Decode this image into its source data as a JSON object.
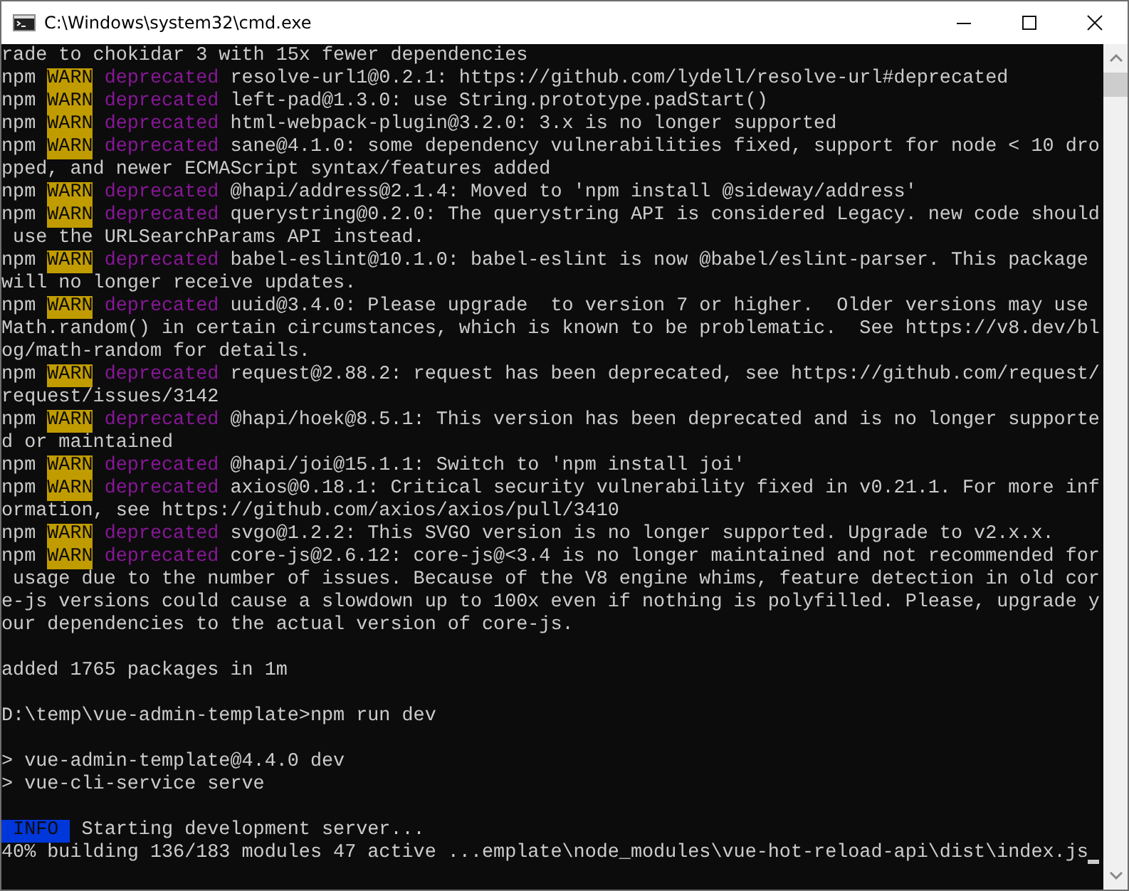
{
  "window": {
    "title": "C:\\Windows\\system32\\cmd.exe"
  },
  "console": {
    "cursor": true,
    "lines": [
      {
        "kind": "plain",
        "text": "rade to chokidar 3 with 15x fewer dependencies"
      },
      {
        "kind": "warn",
        "prefix": "npm",
        "level": "WARN",
        "tag": "deprecated",
        "text": "resolve-url1@0.2.1: https://github.com/lydell/resolve-url#deprecated"
      },
      {
        "kind": "warn",
        "prefix": "npm",
        "level": "WARN",
        "tag": "deprecated",
        "text": "left-pad@1.3.0: use String.prototype.padStart()"
      },
      {
        "kind": "warn",
        "prefix": "npm",
        "level": "WARN",
        "tag": "deprecated",
        "text": "html-webpack-plugin@3.2.0: 3.x is no longer supported"
      },
      {
        "kind": "warn",
        "prefix": "npm",
        "level": "WARN",
        "tag": "deprecated",
        "text": "sane@4.1.0: some dependency vulnerabilities fixed, support for node < 10 dro"
      },
      {
        "kind": "plain",
        "text": "pped, and newer ECMAScript syntax/features added"
      },
      {
        "kind": "warn",
        "prefix": "npm",
        "level": "WARN",
        "tag": "deprecated",
        "text": "@hapi/address@2.1.4: Moved to 'npm install @sideway/address'"
      },
      {
        "kind": "warn",
        "prefix": "npm",
        "level": "WARN",
        "tag": "deprecated",
        "text": "querystring@0.2.0: The querystring API is considered Legacy. new code should"
      },
      {
        "kind": "plain",
        "text": " use the URLSearchParams API instead."
      },
      {
        "kind": "warn",
        "prefix": "npm",
        "level": "WARN",
        "tag": "deprecated",
        "text": "babel-eslint@10.1.0: babel-eslint is now @babel/eslint-parser. This package"
      },
      {
        "kind": "plain",
        "text": "will no longer receive updates."
      },
      {
        "kind": "warn",
        "prefix": "npm",
        "level": "WARN",
        "tag": "deprecated",
        "text": "uuid@3.4.0: Please upgrade  to version 7 or higher.  Older versions may use"
      },
      {
        "kind": "plain",
        "text": "Math.random() in certain circumstances, which is known to be problematic.  See https://v8.dev/bl"
      },
      {
        "kind": "plain",
        "text": "og/math-random for details."
      },
      {
        "kind": "warn",
        "prefix": "npm",
        "level": "WARN",
        "tag": "deprecated",
        "text": "request@2.88.2: request has been deprecated, see https://github.com/request/"
      },
      {
        "kind": "plain",
        "text": "request/issues/3142"
      },
      {
        "kind": "warn",
        "prefix": "npm",
        "level": "WARN",
        "tag": "deprecated",
        "text": "@hapi/hoek@8.5.1: This version has been deprecated and is no longer supporte"
      },
      {
        "kind": "plain",
        "text": "d or maintained"
      },
      {
        "kind": "warn",
        "prefix": "npm",
        "level": "WARN",
        "tag": "deprecated",
        "text": "@hapi/joi@15.1.1: Switch to 'npm install joi'"
      },
      {
        "kind": "warn",
        "prefix": "npm",
        "level": "WARN",
        "tag": "deprecated",
        "text": "axios@0.18.1: Critical security vulnerability fixed in v0.21.1. For more inf"
      },
      {
        "kind": "plain",
        "text": "ormation, see https://github.com/axios/axios/pull/3410"
      },
      {
        "kind": "warn",
        "prefix": "npm",
        "level": "WARN",
        "tag": "deprecated",
        "text": "svgo@1.2.2: This SVGO version is no longer supported. Upgrade to v2.x.x."
      },
      {
        "kind": "warn",
        "prefix": "npm",
        "level": "WARN",
        "tag": "deprecated",
        "text": "core-js@2.6.12: core-js@<3.4 is no longer maintained and not recommended for"
      },
      {
        "kind": "plain",
        "text": " usage due to the number of issues. Because of the V8 engine whims, feature detection in old cor"
      },
      {
        "kind": "plain",
        "text": "e-js versions could cause a slowdown up to 100x even if nothing is polyfilled. Please, upgrade y"
      },
      {
        "kind": "plain",
        "text": "our dependencies to the actual version of core-js."
      },
      {
        "kind": "blank"
      },
      {
        "kind": "plain",
        "text": "added 1765 packages in 1m"
      },
      {
        "kind": "blank"
      },
      {
        "kind": "plain",
        "text": "D:\\temp\\vue-admin-template>npm run dev"
      },
      {
        "kind": "blank"
      },
      {
        "kind": "plain",
        "text": "> vue-admin-template@4.4.0 dev"
      },
      {
        "kind": "plain",
        "text": "> vue-cli-service serve"
      },
      {
        "kind": "blank"
      },
      {
        "kind": "info",
        "level": "INFO",
        "text": "Starting development server..."
      },
      {
        "kind": "plain",
        "text": "40% building 136/183 modules 47 active ...emplate\\node_modules\\vue-hot-reload-api\\dist\\index.js"
      }
    ]
  }
}
